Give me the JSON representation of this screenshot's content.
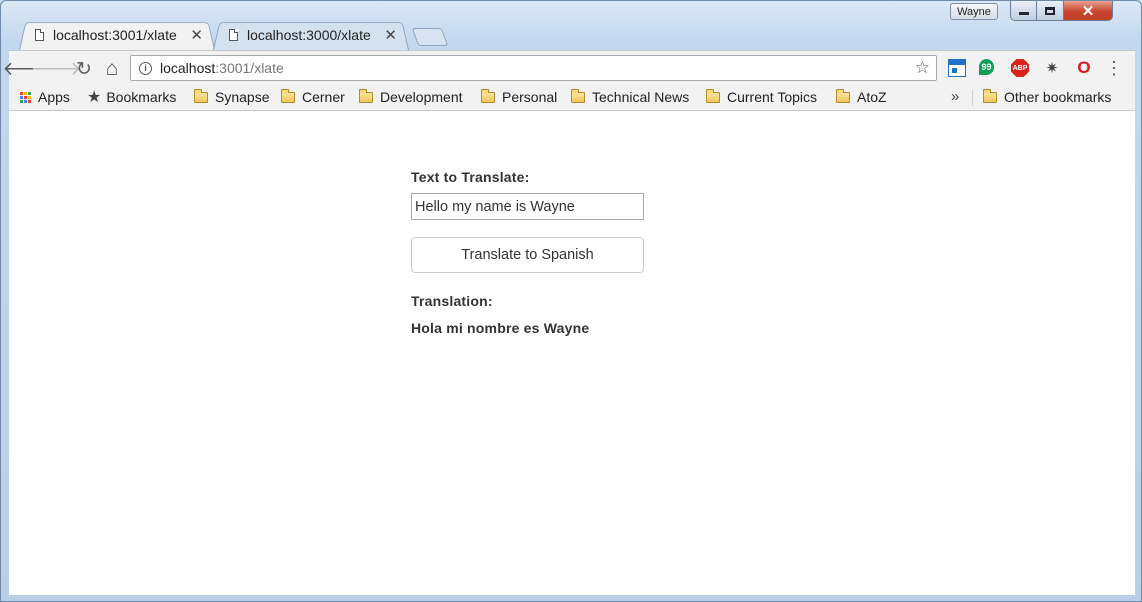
{
  "window": {
    "profile_name": "Wayne",
    "controls": {
      "minimize": "",
      "maximize": "",
      "close": "✕"
    }
  },
  "tabs": [
    {
      "label": "localhost:3001/xlate",
      "close": "✕",
      "active": true
    },
    {
      "label": "localhost:3000/xlate",
      "close": "✕",
      "active": false
    }
  ],
  "toolbar": {
    "back_icon": "🡐",
    "forward_icon": "🡒",
    "reload_icon": "↻",
    "home_icon": "⌂",
    "url_host": "localhost",
    "url_path": ":3001/xlate",
    "star_icon": "☆",
    "info_icon": "i",
    "menu_icon": "⋮",
    "extensions": [
      "calendar-icon",
      "hangouts-icon",
      "adblock-plus-icon",
      "bug-icon",
      "opera-icon"
    ],
    "hangouts_glyph": "99",
    "abp_glyph": "ABP",
    "bug_glyph": "✷",
    "opera_glyph": "O"
  },
  "bookmarks": {
    "apps": "Apps",
    "bookmarks": "Bookmarks",
    "folders": [
      "Synapse",
      "Cerner",
      "Development",
      "Personal",
      "Technical News",
      "Current Topics",
      "AtoZ"
    ],
    "overflow": "»",
    "other": "Other bookmarks",
    "apps_colors": [
      "#ea4335",
      "#fbbc05",
      "#34a853",
      "#4285f4",
      "#ea4335",
      "#fbbc05",
      "#34a853",
      "#4285f4",
      "#ea4335"
    ]
  },
  "page": {
    "text_label": "Text to Translate:",
    "input_value": "Hello my name is Wayne",
    "button_label": "Translate to Spanish",
    "translation_label": "Translation:",
    "translation_value": "Hola mi nombre es Wayne"
  }
}
